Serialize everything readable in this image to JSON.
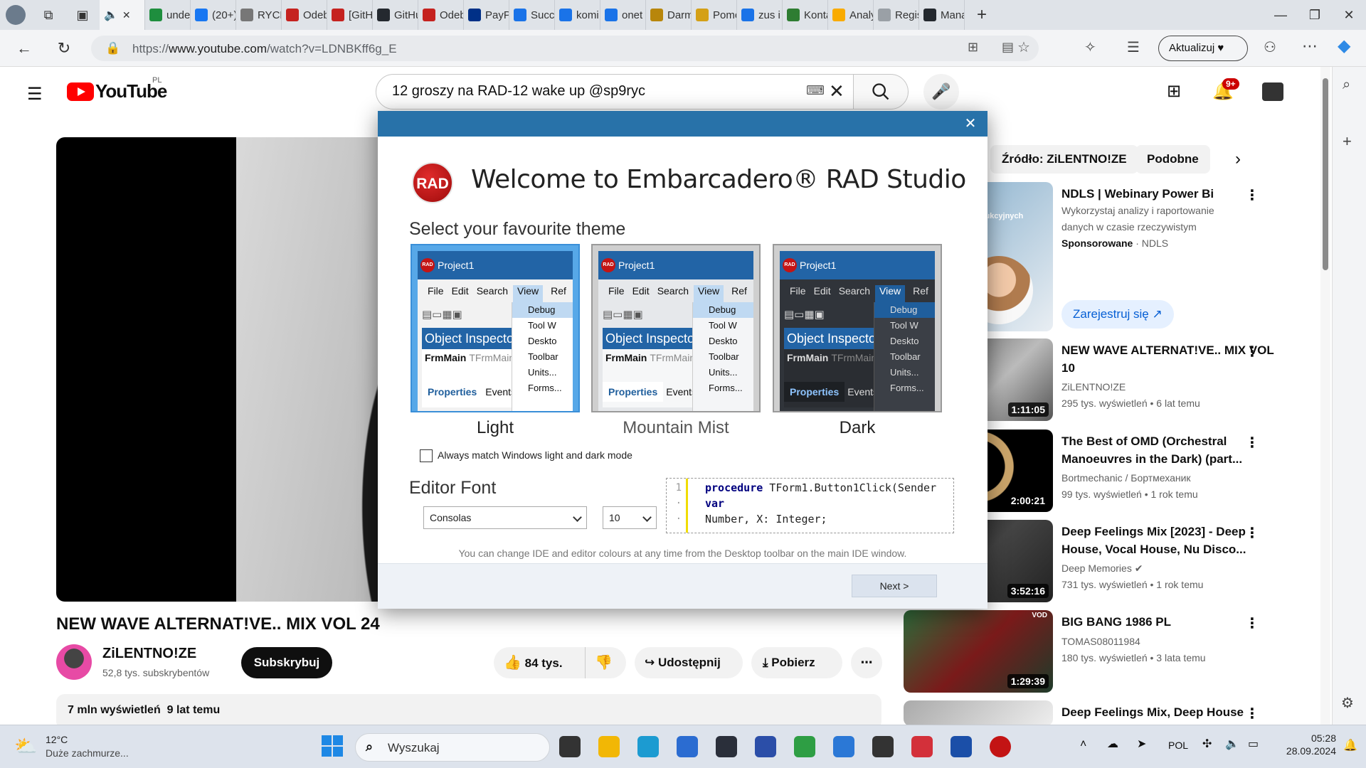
{
  "browser": {
    "tabs": [
      {
        "label": "unde",
        "color": "#1e8e3e"
      },
      {
        "label": "(20+)",
        "color": "#1877f2"
      },
      {
        "label": "RYCH",
        "color": "#777777"
      },
      {
        "label": "Odeb",
        "color": "#c5221f"
      },
      {
        "label": "[GitH",
        "color": "#c5221f"
      },
      {
        "label": "GitHu",
        "color": "#24292f"
      },
      {
        "label": "Odeb",
        "color": "#c5221f"
      },
      {
        "label": "PayPa",
        "color": "#003087"
      },
      {
        "label": "Succe",
        "color": "#1a73e8"
      },
      {
        "label": "komi",
        "color": "#1a73e8"
      },
      {
        "label": "onet",
        "color": "#1a73e8"
      },
      {
        "label": "Darm",
        "color": "#b8860b"
      },
      {
        "label": "Pomo",
        "color": "#d4a017"
      },
      {
        "label": "zus i",
        "color": "#1a73e8"
      },
      {
        "label": "Konta",
        "color": "#2e7d32"
      },
      {
        "label": "Analy",
        "color": "#f9ab00"
      },
      {
        "label": "Regis",
        "color": "#9aa0a6"
      },
      {
        "label": "Mana",
        "color": "#24292f"
      }
    ],
    "active_tab_close": "✕",
    "url_prefix": "https://",
    "url_host": "www.youtube.com",
    "url_path": "/watch?v=LDNBKff6g_E",
    "update_label": "Aktualizuj"
  },
  "youtube": {
    "logo_text": "YouTube",
    "country_code": "PL",
    "search_query": "12 groszy na RAD-12 wake up @sp9ryc",
    "notification_count": "9+",
    "video_title": "NEW WAVE ALTERNAT!VE.. MIX VOL 24",
    "channel_name": "ZiLENTNO!ZE",
    "channel_subs": "52,8 tys. subskrybentów",
    "subscribe_label": "Subskrybuj",
    "likes": "84 tys.",
    "share_label": "Udostępnij",
    "download_label": "Pobierz",
    "views": "7 mln wyświetleń",
    "uploaded": "9 lat temu",
    "chips": [
      "Źródło: ZiLENTNO!ZE",
      "Podobne"
    ],
    "ad": {
      "title": "NDLS | Webinary Power Bi",
      "line1": "Wykorzystaj analizy i raportowanie",
      "line2": "danych w czasie rzeczywistym",
      "sponsored": "Sponsorowane",
      "advertiser": "· NDLS",
      "cta": "Zarejestruj się",
      "thumb_text": "produkcyjnych"
    },
    "recommendations": [
      {
        "title": "NEW WAVE ALTERNAT!VE.. MIX VOL 10",
        "channel": "ZiLENTNO!ZE",
        "meta": "295 tys. wyświetleń  • 6 lat temu",
        "duration": "1:11:05"
      },
      {
        "title": "The Best of OMD (Orchestral Manoeuvres in the Dark) (part...",
        "channel": "Bortmechanic / Бортмеханик",
        "meta": "99 tys. wyświetleń  • 1 rok temu",
        "duration": "2:00:21"
      },
      {
        "title": "Deep Feelings Mix [2023] - Deep House, Vocal House, Nu Disco...",
        "channel": "Deep Memories",
        "meta": "731 tys. wyświetleń  • 1 rok temu",
        "duration": "3:52:16"
      },
      {
        "title": "BIG BANG 1986 PL",
        "channel": "TOMAS08011984",
        "meta": "180 tys. wyświetleń  • 3 lata temu",
        "duration": "1:29:39",
        "badge": "VOD"
      },
      {
        "title": "Deep Feelings Mix, Deep House",
        "channel": "",
        "meta": "",
        "duration": ""
      }
    ]
  },
  "dialog": {
    "close_label": "✕",
    "logo_text": "RAD",
    "title": "Welcome to Embarcadero® RAD Studio",
    "theme_heading": "Select your favourite theme",
    "themes": [
      {
        "name": "Light",
        "window_title": "Project1"
      },
      {
        "name": "Mountain Mist",
        "window_title": "Project1"
      },
      {
        "name": "Dark",
        "window_title": "Project1"
      }
    ],
    "preview_menu": [
      "File",
      "Edit",
      "Search",
      "View",
      "Ref"
    ],
    "preview_dropdown": [
      "Debug",
      "Tool W",
      "Deskto",
      "Toolbar",
      "Units...",
      "Forms..."
    ],
    "preview_oi_title": "Object Inspector",
    "preview_oi_row_name": "FrmMain",
    "preview_oi_row_type": "TFrmMain",
    "preview_oi_tab_properties": "Properties",
    "preview_oi_tab_events": "Events",
    "match_windows_label": "Always match Windows light and dark mode",
    "font_heading": "Editor Font",
    "font_name": "Consolas",
    "font_size": "10",
    "code_lines": [
      {
        "num": "1",
        "kw": "procedure",
        "text": " TForm1.Button1Click(Sender"
      },
      {
        "num": "·",
        "kw": "var",
        "text": ""
      },
      {
        "num": "·",
        "kw": "",
        "text": "  Number, X: Integer;"
      }
    ],
    "note": "You can change IDE and editor colours at any time from the Desktop toolbar on the main IDE window.",
    "next_label": "Next >"
  },
  "taskbar": {
    "temperature": "12°C",
    "weather": "Duże zachmurze...",
    "search_placeholder": "Wyszukaj",
    "language": "POL",
    "time": "05:28",
    "date": "28.09.2024"
  }
}
